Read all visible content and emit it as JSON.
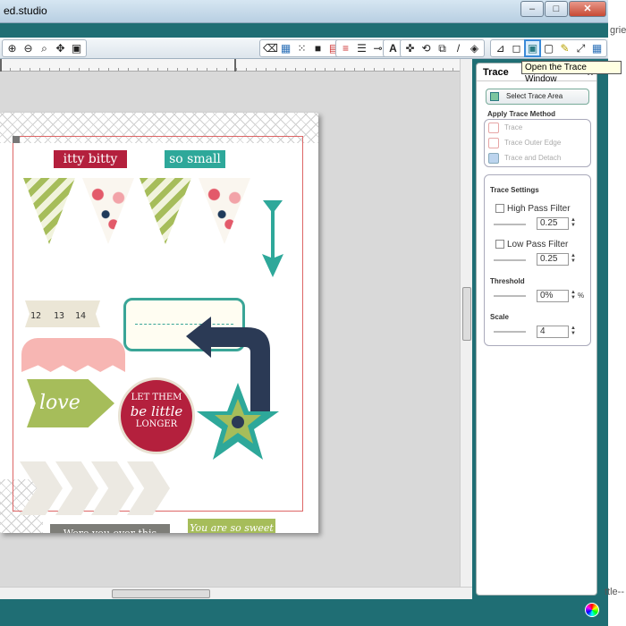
{
  "window": {
    "title": "ed.studio",
    "minimize": "–",
    "maximize": "□",
    "close": "✕"
  },
  "right_window": {
    "fragment_top": "grie",
    "fragment_bottom": "ttle--"
  },
  "toolbar": {
    "left_icons": [
      "zoom-in-icon",
      "zoom-out-icon",
      "zoom-select-icon",
      "pan-icon",
      "fit-page-icon"
    ],
    "right_icons": [
      "eraser-icon",
      "grid-icon",
      "grid-dots-icon",
      "fill-icon",
      "registration-icon",
      "line-color-icon",
      "line-style-icon",
      "knife-icon",
      "text-icon",
      "transform-icon",
      "rotate-icon",
      "replicate-icon",
      "pen-icon",
      "weld-icon",
      "align-icon",
      "offset-icon",
      "trace-icon",
      "page-icon",
      "pencil-icon",
      "expand-icon",
      "library-icon"
    ]
  },
  "tooltip": "Open the Trace Window",
  "canvas": {
    "labels": {
      "itty_bitty": "itty bitty",
      "so_small": "so small",
      "love": "love",
      "let_them": "LET THEM",
      "be_little": "be little",
      "longer": "LONGER",
      "were_you": "Were you ever this little?",
      "you_are": "You are so sweet"
    },
    "ruler_numbers": [
      "12",
      "13",
      "14"
    ]
  },
  "trace_panel": {
    "title": "Trace",
    "close": "x",
    "select_trace_area": "Select Trace Area",
    "apply_trace_method": "Apply Trace Method",
    "methods": [
      "Trace",
      "Trace Outer Edge",
      "Trace and Detach"
    ],
    "trace_settings": "Trace Settings",
    "high_pass_filter": {
      "label": "High Pass Filter",
      "value": "0.25"
    },
    "low_pass_filter": {
      "label": "Low Pass Filter",
      "value": "0.25"
    },
    "threshold": {
      "label": "Threshold",
      "value": "0%",
      "unit": "%"
    },
    "scale": {
      "label": "Scale",
      "value": "4"
    }
  },
  "colors": {
    "frame": "#1f6e74",
    "accent_red": "#b4203d",
    "accent_teal": "#2ea89a",
    "accent_green": "#a6bd5a"
  }
}
